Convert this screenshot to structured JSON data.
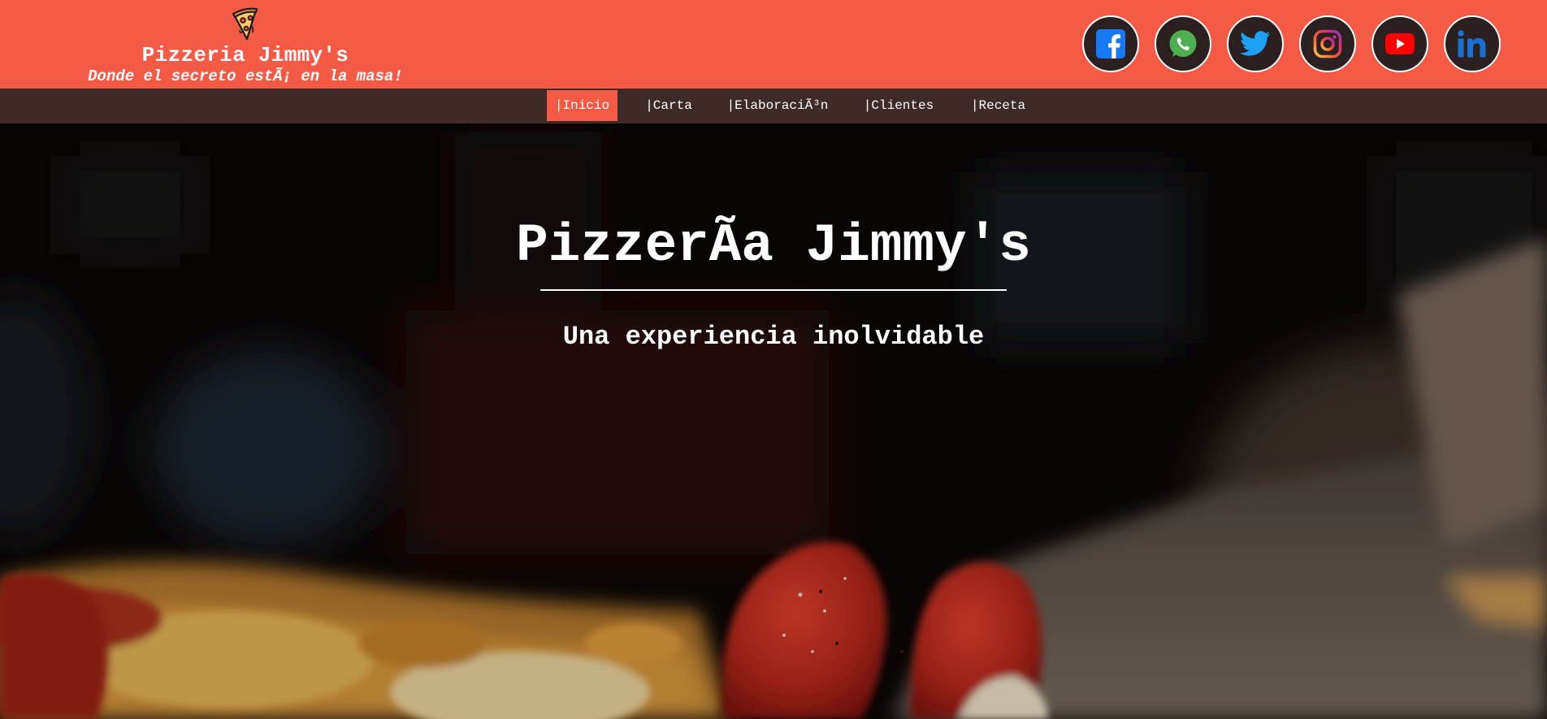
{
  "header": {
    "logo_icon": "pizza-slice-icon",
    "title": "Pizzeria Jimmy's",
    "slogan": "Donde el secreto estÃ¡ en la masa!",
    "colors": {
      "header_bg": "#f55a47",
      "nav_bg": "#3e2a26",
      "active_tab": "#f55a47"
    }
  },
  "social": [
    {
      "name": "facebook",
      "icon": "facebook-icon",
      "color": "#1877f2"
    },
    {
      "name": "whatsapp",
      "icon": "whatsapp-icon",
      "color": "#4caf50"
    },
    {
      "name": "twitter",
      "icon": "twitter-icon",
      "color": "#1da1f2"
    },
    {
      "name": "instagram",
      "icon": "instagram-icon",
      "color": "#e1306c"
    },
    {
      "name": "youtube",
      "icon": "youtube-icon",
      "color": "#ff0000"
    },
    {
      "name": "linkedin",
      "icon": "linkedin-icon",
      "color": "#1a6fd0"
    }
  ],
  "nav": {
    "items": [
      {
        "label": "|Inicio",
        "active": true
      },
      {
        "label": "|Carta",
        "active": false
      },
      {
        "label": "|ElaboraciÃ³n",
        "active": false
      },
      {
        "label": "|Clientes",
        "active": false
      },
      {
        "label": "|Receta",
        "active": false
      }
    ]
  },
  "hero": {
    "title": "PizzerÃa Jimmy's",
    "subtitle": "Una experiencia inolvidable"
  }
}
